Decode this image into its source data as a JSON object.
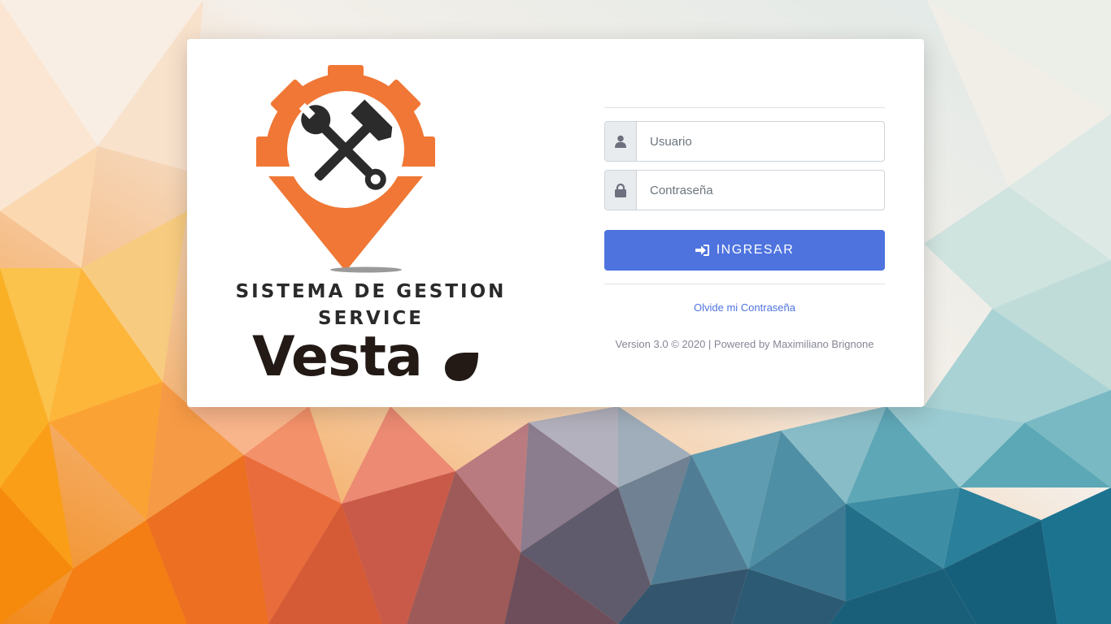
{
  "logo": {
    "line1": "SISTEMA DE GESTION",
    "line2": "SERVICE",
    "brand": "Vesta",
    "accent_color": "#f07735",
    "icon": "hammer-wrench-gear-pin-icon"
  },
  "form": {
    "username": {
      "placeholder": "Usuario",
      "value": "",
      "icon": "user-icon"
    },
    "password": {
      "placeholder": "Contraseña",
      "value": "",
      "icon": "lock-icon"
    },
    "submit_label": "INGRESAR",
    "submit_icon": "sign-in-icon",
    "submit_color": "#4e73df"
  },
  "links": {
    "forgot_password": "Olvide mi Contraseña"
  },
  "footer": {
    "version": "Version 3.0 © 2020 | Powered by Maximiliano Brignone"
  }
}
